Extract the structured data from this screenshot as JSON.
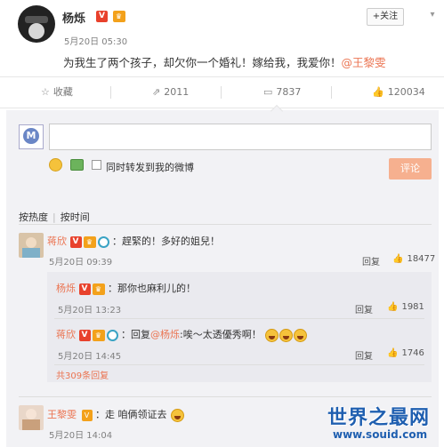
{
  "post": {
    "author": "杨烁",
    "v_badge": "V",
    "vip_badge": "1级",
    "time": "5月20日 05:30",
    "follow_label": "+关注",
    "text": "为我生了两个孩子，却欠你一个婚礼！嫁给我，我爱你！",
    "mention": "@王黎雯"
  },
  "actions": {
    "favorite": "收藏",
    "forward": "2011",
    "comment": "7837",
    "like": "120034"
  },
  "composer": {
    "share_label": "同时转发到我的微博",
    "submit_label": "评论"
  },
  "sort": {
    "hot": "按热度",
    "time": "按时间"
  },
  "comments": [
    {
      "name": "蒋欣",
      "text": "：趕緊的！多好的姐兒！",
      "time": "5月20日 09:39",
      "reply": "回复",
      "likes": "18477"
    }
  ],
  "replies": [
    {
      "name": "杨烁",
      "text": "：那你也麻利儿的！",
      "time": "5月20日 13:23",
      "reply": "回复",
      "likes": "1981"
    },
    {
      "name": "蒋欣",
      "text_prefix": "：回复",
      "mention": "@杨烁",
      "text": ":唉～太透優秀啊！",
      "time": "5月20日 14:45",
      "reply": "回复",
      "likes": "1746"
    }
  ],
  "more_replies": "共309条回复",
  "last_comment": {
    "name": "王黎雯",
    "text": "：走 咱俩领证去",
    "time": "5月20日 14:04"
  },
  "watermark": {
    "title": "世界之最网",
    "url": "www.souid.com"
  }
}
